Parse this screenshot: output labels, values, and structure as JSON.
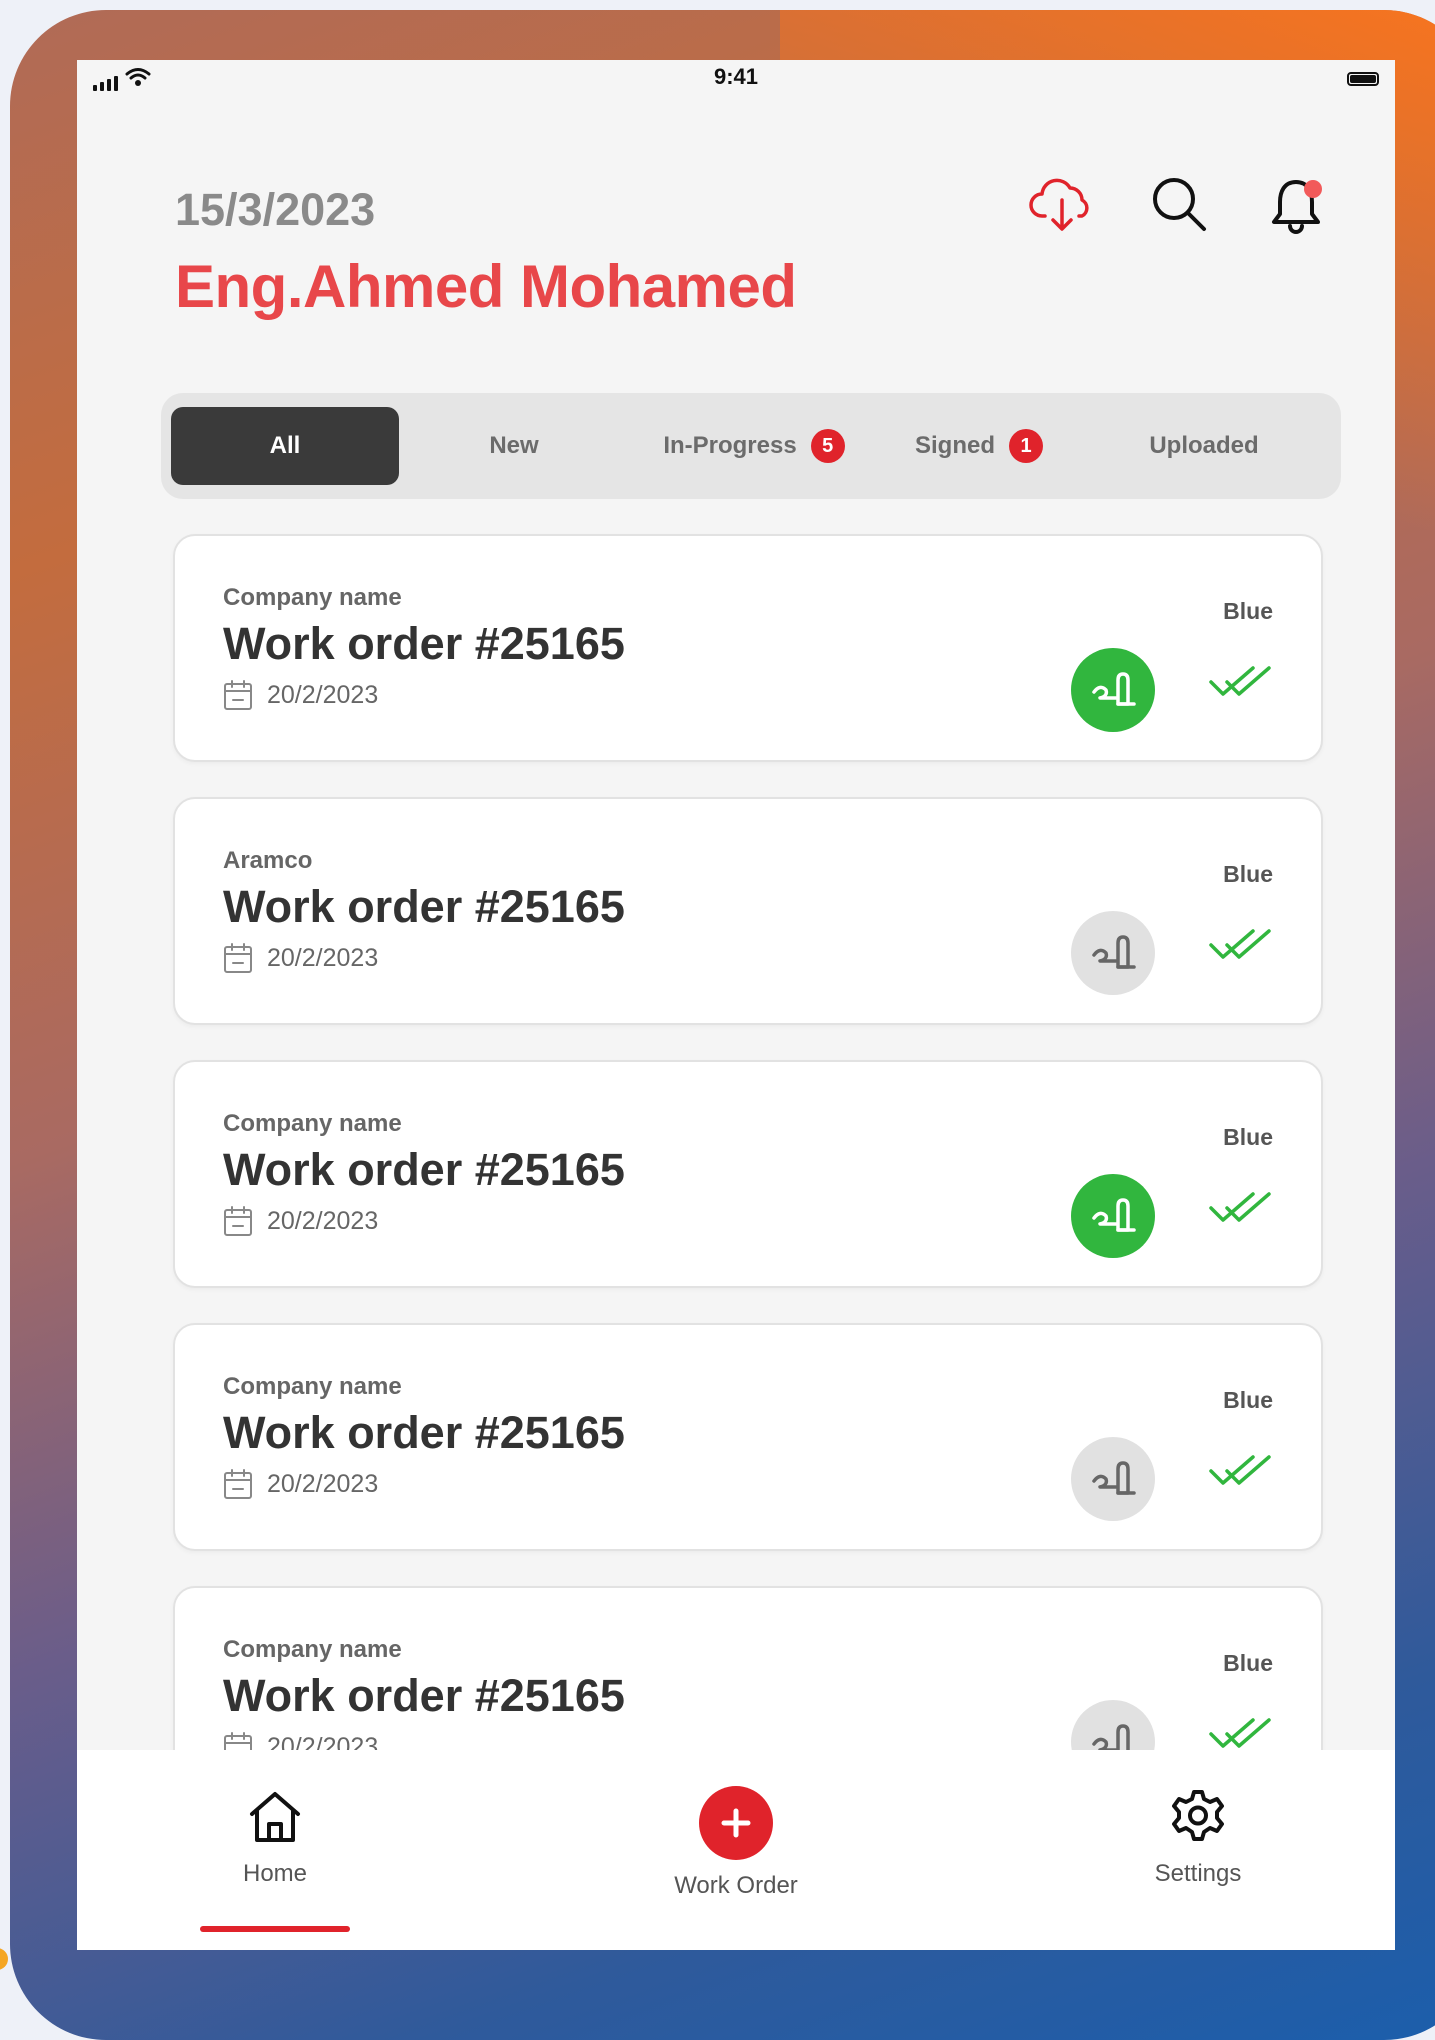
{
  "status_bar": {
    "time": "9:41"
  },
  "header": {
    "date": "15/3/2023",
    "user_name": "Eng.Ahmed Mohamed",
    "icons": [
      "cloud-download-icon",
      "search-icon",
      "bell-icon"
    ],
    "notification_dot": true
  },
  "tabs": [
    {
      "label": "All",
      "active": true
    },
    {
      "label": "New"
    },
    {
      "label": "In-Progress",
      "badge": "5"
    },
    {
      "label": "Signed",
      "badge": "1"
    },
    {
      "label": "Uploaded"
    }
  ],
  "work_orders": [
    {
      "company": "Company name",
      "title": "Work order #25165",
      "date": "20/2/2023",
      "status": "Blue",
      "signed": true
    },
    {
      "company": "Aramco",
      "title": "Work order #25165",
      "date": "20/2/2023",
      "status": "Blue",
      "signed": false
    },
    {
      "company": "Company name",
      "title": "Work order #25165",
      "date": "20/2/2023",
      "status": "Blue",
      "signed": true
    },
    {
      "company": "Company name",
      "title": "Work order #25165",
      "date": "20/2/2023",
      "status": "Blue",
      "signed": false
    },
    {
      "company": "Company name",
      "title": "Work order #25165",
      "date": "20/2/2023",
      "status": "Blue",
      "signed": false
    }
  ],
  "bottom_nav": [
    {
      "label": "Home",
      "icon": "home-icon",
      "active": true
    },
    {
      "label": "Work Order",
      "icon": "plus-icon"
    },
    {
      "label": "Settings",
      "icon": "gear-icon"
    }
  ],
  "colors": {
    "accent_red": "#e0232b",
    "name_red": "#e8474a",
    "sign_green": "#31b63e",
    "check_green": "#31b63e",
    "active_tab": "#3a3a3a"
  }
}
